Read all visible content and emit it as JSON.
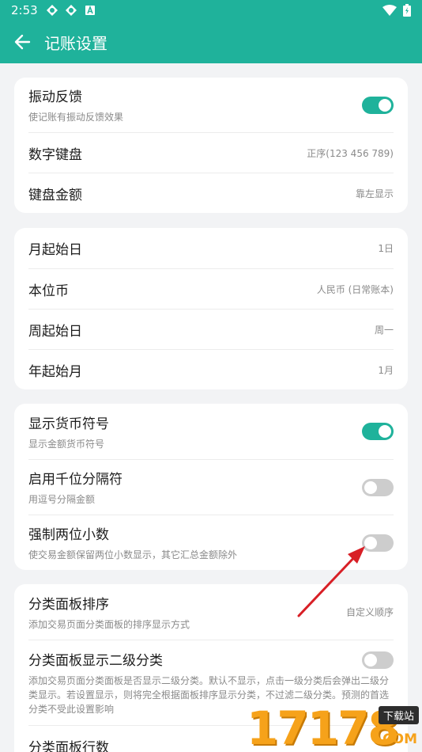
{
  "status_bar": {
    "time": "2:53"
  },
  "header": {
    "title": "记账设置"
  },
  "groups": [
    {
      "rows": [
        {
          "label": "振动反馈",
          "desc": "使记账有振动反馈效果",
          "switch": true
        },
        {
          "label": "数字键盘",
          "value": "正序(123 456 789)"
        },
        {
          "label": "键盘金额",
          "value": "靠左显示"
        }
      ]
    },
    {
      "rows": [
        {
          "label": "月起始日",
          "value": "1日"
        },
        {
          "label": "本位币",
          "value": "人民币 (日常账本)"
        },
        {
          "label": "周起始日",
          "value": "周一"
        },
        {
          "label": "年起始月",
          "value": "1月"
        }
      ]
    },
    {
      "rows": [
        {
          "label": "显示货币符号",
          "desc": "显示金额货币符号",
          "switch": true
        },
        {
          "label": "启用千位分隔符",
          "desc": "用逗号分隔金额",
          "switch": false
        },
        {
          "label": "强制两位小数",
          "desc": "使交易金额保留两位小数显示，其它汇总金额除外",
          "switch": false
        }
      ]
    },
    {
      "rows": [
        {
          "label": "分类面板排序",
          "desc": "添加交易页面分类面板的排序显示方式",
          "value": "自定义顺序"
        },
        {
          "label": "分类面板显示二级分类",
          "desc": "添加交易页面分类面板是否显示二级分类。默认不显示，点击一级分类后会弹出二级分类显示。若设置显示，则将完全根据面板排序显示分类，不过滤二级分类。预测的首选分类不受此设置影响",
          "switch": false
        },
        {
          "label": "分类面板行数"
        }
      ]
    }
  ],
  "watermark": {
    "number": "17178",
    "badge": "下载站",
    "suffix": ".COM"
  },
  "colors": {
    "accent": "#1fb29b",
    "background": "#f2f3f5",
    "arrow": "#d81f26"
  }
}
